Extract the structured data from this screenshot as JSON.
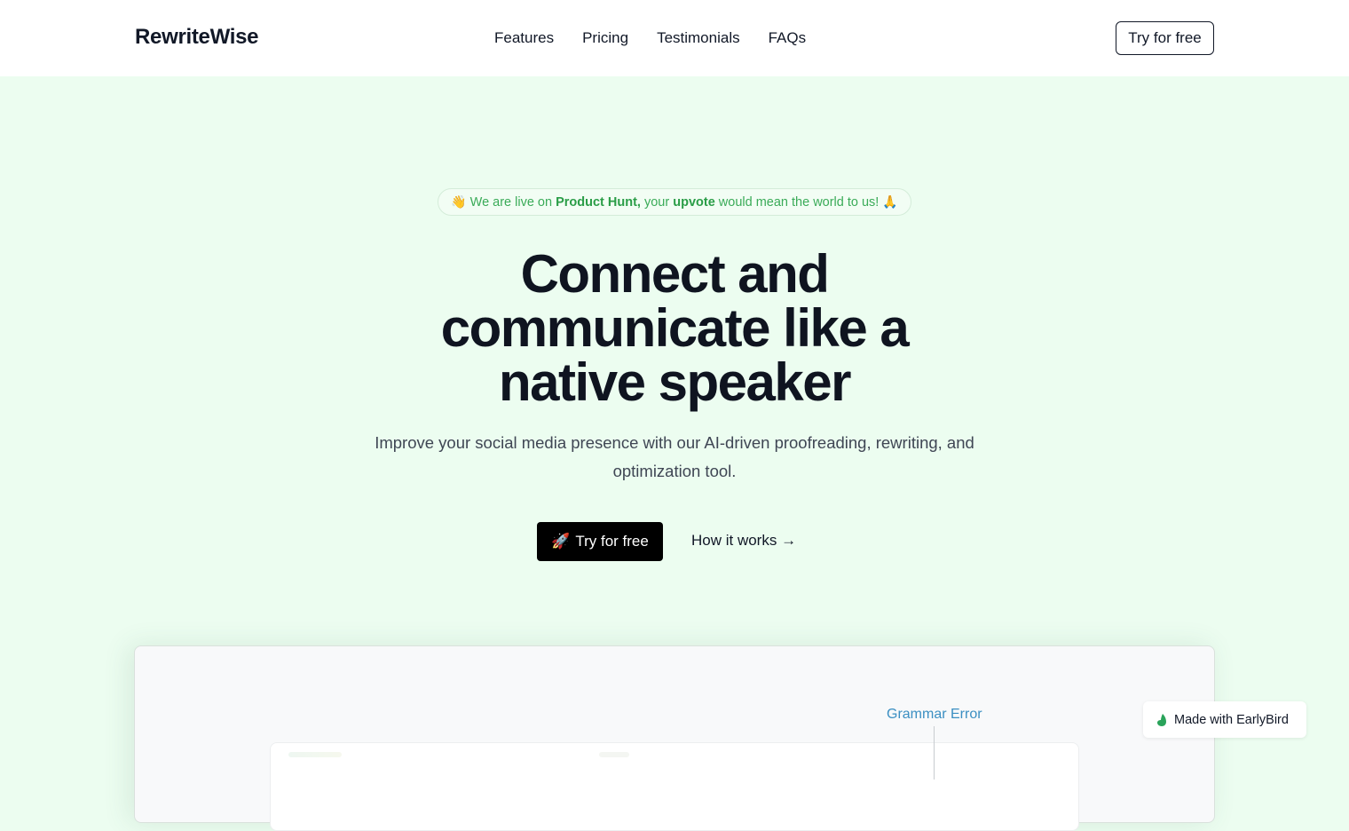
{
  "header": {
    "logo": "RewriteWise",
    "nav": [
      {
        "label": "Features"
      },
      {
        "label": "Pricing"
      },
      {
        "label": "Testimonials"
      },
      {
        "label": "FAQs"
      }
    ],
    "cta_label": "Try for free"
  },
  "announcement": {
    "icon_start": "👋",
    "text_1": "We are live on",
    "bold_1": "Product Hunt,",
    "text_2": "your",
    "bold_2": "upvote",
    "text_3": "would mean the world to us!",
    "icon_end": "🙏"
  },
  "hero": {
    "title_line_1": "Connect and",
    "title_line_2": "communicate like a",
    "title_line_3": "native speaker",
    "subtitle": "Improve your social media presence with our AI-driven proofreading, rewriting, and optimization tool.",
    "primary_cta": {
      "icon": "🚀",
      "label": "Try for free"
    },
    "secondary_cta": "How it works →"
  },
  "preview": {
    "annotation_label": "Grammar Error",
    "annotation_color": "#3b8fc2"
  },
  "badge": {
    "label": "Made with EarlyBird",
    "icon_color": "#2aa35a"
  },
  "colors": {
    "hero_background": "#ecfdf0",
    "announcement_text": "#3aab58",
    "primary_button": "#000000"
  }
}
